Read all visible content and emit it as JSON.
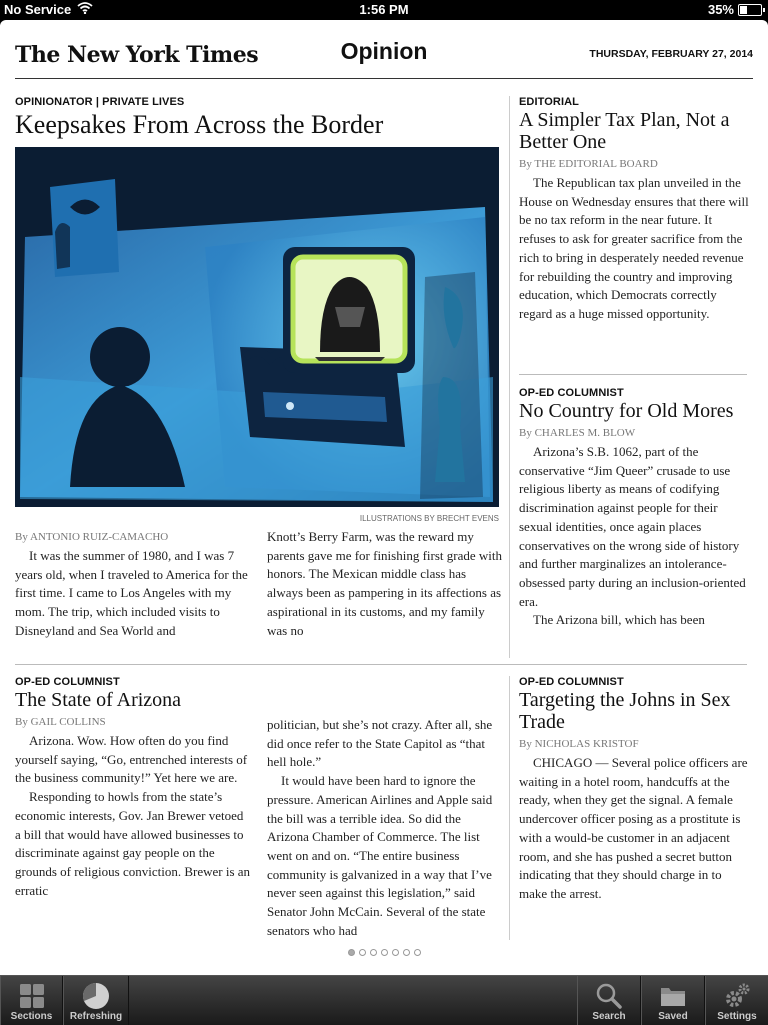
{
  "status_bar": {
    "carrier": "No Service",
    "time": "1:56 PM",
    "battery_percent": "35%",
    "battery_level": 0.35
  },
  "masthead": {
    "logo": "The New York Times",
    "section": "Opinion",
    "date": "THURSDAY, FEBRUARY 27, 2014"
  },
  "lead": {
    "kicker": "OPINIONATOR | PRIVATE LIVES",
    "headline": "Keepsakes From Across the Border",
    "credit": "ILLUSTRATIONS BY BRECHT EVENS",
    "by": "By",
    "author": "ANTONIO RUIZ-CAMACHO",
    "col1": "It was the summer of 1980, and I was 7 years old, when I traveled to America for the first time. I came to Los Angeles with my mom. The trip, which included visits to Disneyland and Sea World and",
    "col2": "Knott’s Berry Farm, was the reward my parents gave me for finishing first grade with honors. The Mexican middle class has always been as pampering in its affections as aspirational in its customs, and my family was no"
  },
  "editorial": {
    "kicker": "EDITORIAL",
    "headline": "A Simpler Tax Plan, Not a Better One",
    "by": "By",
    "author": "THE EDITORIAL BOARD",
    "body": "The Republican tax plan unveiled in the House on Wednesday ensures that there will be no tax reform in the near future. It refuses to ask for greater sacrifice from the rich to bring in desperately needed revenue for rebuilding the country and improving education, which Democrats correctly regard as a huge missed opportunity."
  },
  "blow": {
    "kicker": "OP-ED COLUMNIST",
    "headline": "No Country for Old Mores",
    "by": "By",
    "author": "CHARLES M. BLOW",
    "p1": "Arizona’s S.B. 1062, part of the conservative “Jim Queer” crusade to use religious liberty as means of codifying discrimination against people for their sexual identities, once again places conservatives on the wrong side of history and further marginalizes an intolerance-obsessed party during an inclusion-oriented era.",
    "p2": "The Arizona bill, which has been"
  },
  "collins": {
    "kicker": "OP-ED COLUMNIST",
    "headline": "The State of Arizona",
    "by": "By",
    "author": "GAIL COLLINS",
    "col1_p1": "Arizona. Wow. How often do you find yourself saying, “Go, entrenched interests of the business community!” Yet here we are.",
    "col1_p2": "Responding to howls from the state’s economic interests, Gov. Jan Brewer vetoed a bill that would have allowed businesses to discriminate against gay people on the grounds of religious conviction. Brewer is an erratic",
    "col2_p1": "politician, but she’s not crazy. After all, she did once refer to the State Capitol as “that hell hole.”",
    "col2_p2": "It would have been hard to ignore the pressure. American Airlines and Apple said the bill was a terrible idea. So did the Arizona Chamber of Commerce. The list went on and on. “The entire business community is galvanized in a way that I’ve never seen against this legislation,” said Senator John McCain. Several of the state senators who had"
  },
  "kristof": {
    "kicker": "OP-ED COLUMNIST",
    "headline": "Targeting the Johns in Sex Trade",
    "by": "By",
    "author": "NICHOLAS KRISTOF",
    "body": "CHICAGO — Several police officers are waiting in a hotel room, handcuffs at the ready, when they get the signal. A female undercover officer posing as a prostitute is with a would-be customer in an adjacent room, and she has pushed a secret button indicating that they should charge in to make the arrest."
  },
  "pager": {
    "pages": 7,
    "current": 1
  },
  "toolbar": {
    "sections": "Sections",
    "refreshing": "Refreshing",
    "search": "Search",
    "saved": "Saved",
    "settings": "Settings"
  },
  "icons": {
    "wifi": "wifi-icon",
    "battery": "battery-icon",
    "sections": "grid-icon",
    "refreshing": "pie-progress-icon",
    "search": "magnifier-icon",
    "saved": "folder-icon",
    "settings": "gears-icon"
  }
}
